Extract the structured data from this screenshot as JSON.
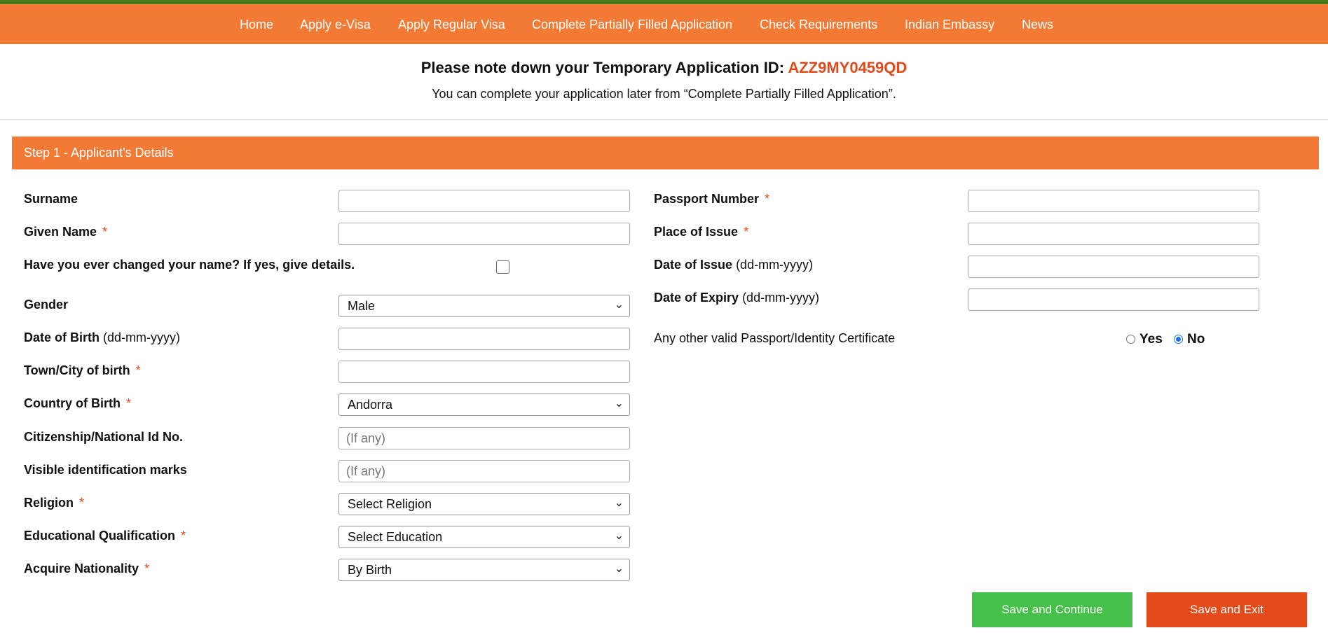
{
  "nav": [
    "Home",
    "Apply e-Visa",
    "Apply Regular Visa",
    "Complete Partially Filled Application",
    "Check Requirements",
    "Indian Embassy",
    "News"
  ],
  "notice": {
    "title": "Please note down your Temporary Application ID: ",
    "app_id": "AZZ9MY0459QD",
    "subtitle": "You can complete your application later from “Complete Partially Filled Application”."
  },
  "step_title": "Step 1 - Applicant's Details",
  "left": {
    "surname": "Surname",
    "given_name": "Given Name",
    "name_changed": "Have you ever changed your name? If yes, give details.",
    "gender": "Gender",
    "gender_value": "Male",
    "dob": "Date of Birth",
    "dob_fmt": "(dd-mm-yyyy)",
    "town": "Town/City of birth",
    "country": "Country of Birth",
    "country_value": "Andorra",
    "citizenship": "Citizenship/National Id No.",
    "citizenship_ph": "(If any)",
    "marks": "Visible identification marks",
    "marks_ph": "(If any)",
    "religion": "Religion",
    "religion_value": "Select Religion",
    "education": "Educational Qualification",
    "education_value": "Select Education",
    "nationality": "Acquire Nationality",
    "nationality_value": "By Birth"
  },
  "right": {
    "passport_no": "Passport Number",
    "place": "Place of Issue",
    "doi": "Date of Issue",
    "doi_fmt": "(dd-mm-yyyy)",
    "doe": "Date of Expiry",
    "doe_fmt": "(dd-mm-yyyy)",
    "other_passport": "Any other valid Passport/Identity Certificate",
    "yes": "Yes",
    "no": "No",
    "selected": "No"
  },
  "required_mark": "*",
  "buttons": {
    "continue": "Save and Continue",
    "exit": "Save and Exit"
  },
  "colors": {
    "orange": "#f37a35",
    "id_red": "#e04a1c",
    "green": "#46c04a",
    "exit_red": "#e44a1a"
  }
}
